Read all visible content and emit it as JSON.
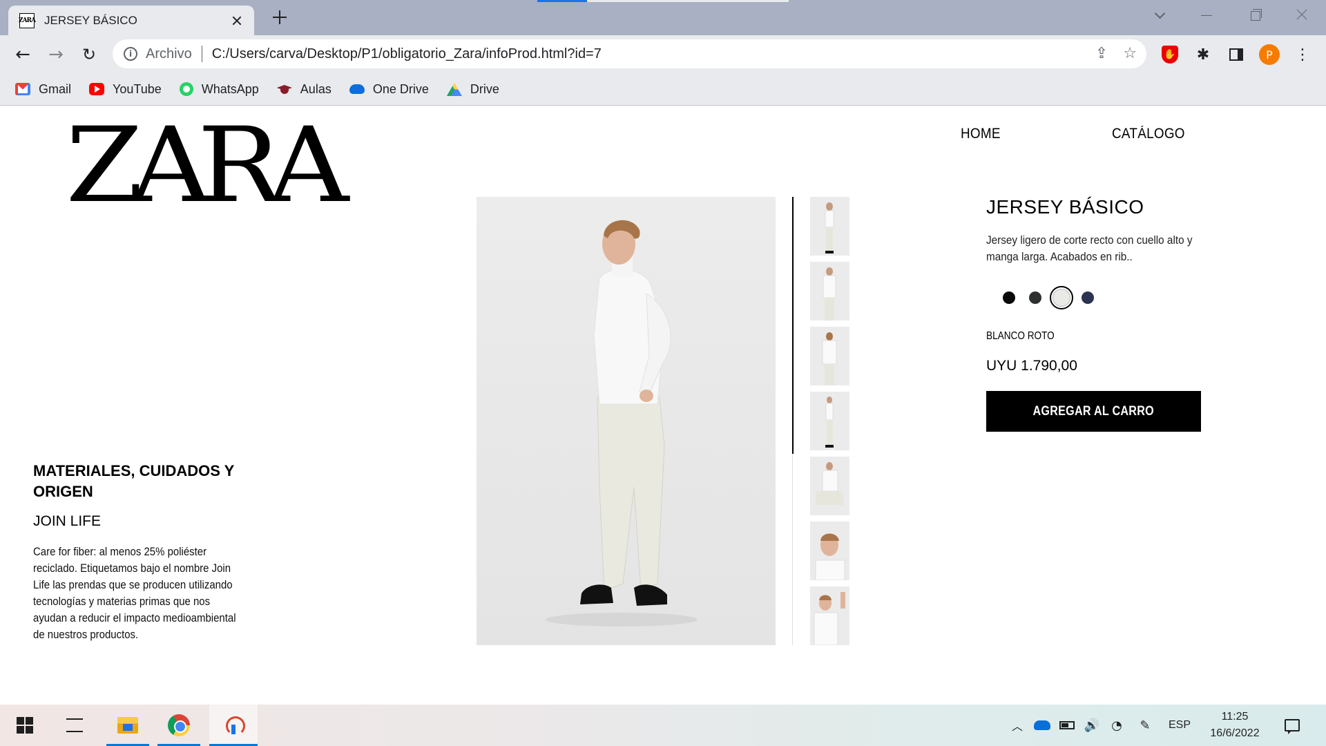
{
  "browser": {
    "tab_title": "JERSEY BÁSICO",
    "favicon_text": "ZARA",
    "omnibox": {
      "security_label": "Archivo",
      "url": "C:/Users/carva/Desktop/P1/obligatorio_Zara/infoProd.html?id=7"
    },
    "profile_initial": "P",
    "bookmarks": [
      {
        "label": "Gmail",
        "icon": "gmail-icon"
      },
      {
        "label": "YouTube",
        "icon": "youtube-icon"
      },
      {
        "label": "WhatsApp",
        "icon": "whatsapp-icon"
      },
      {
        "label": "Aulas",
        "icon": "graduation-cap-icon"
      },
      {
        "label": "One Drive",
        "icon": "onedrive-icon"
      },
      {
        "label": "Drive",
        "icon": "google-drive-icon"
      }
    ]
  },
  "site": {
    "logo": "ZARA",
    "nav": {
      "home": "HOME",
      "catalog": "CATÁLOGO"
    }
  },
  "materials": {
    "heading": "MATERIALES, CUIDADOS Y ORIGEN",
    "subheading": "JOIN LIFE",
    "text": "Care for fiber: al menos 25% poliéster reciclado. Etiquetamos bajo el nombre Join Life las prendas que se producen utilizando tecnologías y materias primas que nos ayudan a reducir el impacto medioambiental de nuestros productos."
  },
  "product": {
    "title": "JERSEY BÁSICO",
    "description": "Jersey ligero de corte recto con cuello alto y manga larga. Acabados en rib..",
    "colors": [
      {
        "hex": "#0a0a0a",
        "selected": false
      },
      {
        "hex": "#2f3030",
        "selected": false
      },
      {
        "hex": "#e9e9e6",
        "selected": true
      },
      {
        "hex": "#2c3454",
        "selected": false
      }
    ],
    "color_name": "BLANCO ROTO",
    "price": "UYU 1.790,00",
    "add_to_cart": "AGREGAR AL CARRO",
    "thumbnail_count": 7
  },
  "taskbar": {
    "language": "ESP",
    "time": "11:25",
    "date": "16/6/2022"
  },
  "colors": {
    "accent_blue": "#1a73e8",
    "button_black": "#000000"
  }
}
